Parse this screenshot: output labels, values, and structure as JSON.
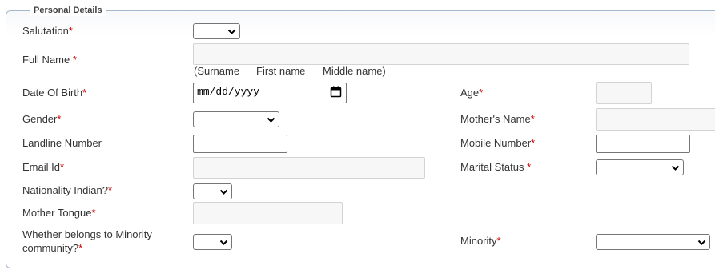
{
  "section": {
    "legend": "Personal Details"
  },
  "fields": {
    "salutation": {
      "label": "Salutation",
      "req": "*",
      "value": ""
    },
    "full_name": {
      "label": "Full Name ",
      "req": "*",
      "value": "",
      "hint_surname": "(Surname",
      "hint_first": "First name",
      "hint_middle": "Middle name)"
    },
    "dob": {
      "label": "Date Of Birth",
      "req": "*",
      "value": "mm/dd/yyyy"
    },
    "age": {
      "label": "Age",
      "req": "*",
      "value": ""
    },
    "gender": {
      "label": "Gender",
      "req": "*",
      "value": ""
    },
    "mothers_name": {
      "label": "Mother's Name",
      "req": "*",
      "value": ""
    },
    "landline": {
      "label": "Landline Number",
      "value": ""
    },
    "mobile": {
      "label": "Mobile Number",
      "req": "*",
      "value": ""
    },
    "email": {
      "label": "Email Id",
      "req": "*",
      "value": ""
    },
    "marital_status": {
      "label": "Marital Status ",
      "req": "*",
      "value": ""
    },
    "nationality": {
      "label": "Nationality Indian?",
      "req": "*",
      "value": ""
    },
    "mother_tongue": {
      "label": "Mother Tongue",
      "req": "*",
      "value": ""
    },
    "minority_belongs": {
      "label_line1": "Whether belongs to Minority",
      "label_line2": "community?",
      "req": "*",
      "value": ""
    },
    "minority": {
      "label": "Minority",
      "req": "*",
      "value": ""
    }
  }
}
